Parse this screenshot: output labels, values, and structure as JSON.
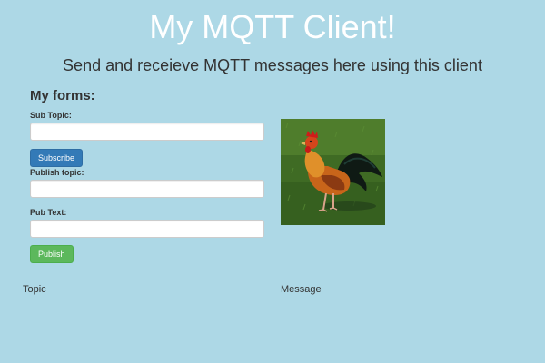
{
  "header": {
    "title": "My MQTT Client!",
    "subtitle": "Send and receieve MQTT messages here using this client"
  },
  "forms": {
    "heading": "My forms:",
    "sub_topic": {
      "label": "Sub Topic:",
      "value": "",
      "placeholder": ""
    },
    "subscribe_label": "Subscribe",
    "publish_topic": {
      "label": "Publish topic:",
      "value": "",
      "placeholder": ""
    },
    "pub_text": {
      "label": "Pub Text:",
      "value": "",
      "placeholder": ""
    },
    "publish_label": "Publish"
  },
  "messages_table": {
    "columns": [
      "Topic",
      "Message"
    ]
  },
  "colors": {
    "page_background": "#add8e6",
    "title_text": "#ffffff",
    "subscribe_button": "#337ab7",
    "publish_button": "#5cb85c"
  },
  "image": {
    "subject": "rooster"
  }
}
